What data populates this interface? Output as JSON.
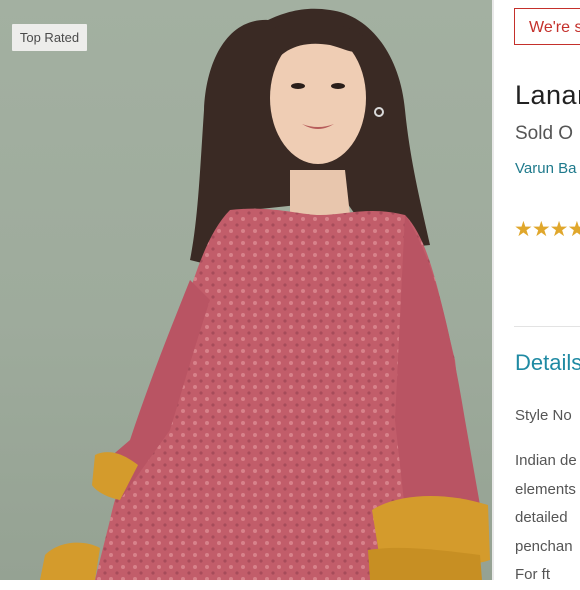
{
  "badge": {
    "label": "Top Rated"
  },
  "promo": {
    "text": "We're s"
  },
  "product": {
    "title": "Lanar",
    "status": "Sold O",
    "brand": "Varun Ba",
    "rating_stars": "★★★★"
  },
  "details": {
    "heading": "Details",
    "style_label": "Style No",
    "description_lines": [
      "Indian de",
      "elements",
      "detailed",
      "penchan",
      "For ft"
    ]
  },
  "colors": {
    "accent": "#1f8aa3",
    "promo": "#c4302b",
    "star": "#e0a72c",
    "photo_bg": "#9eab9c"
  }
}
